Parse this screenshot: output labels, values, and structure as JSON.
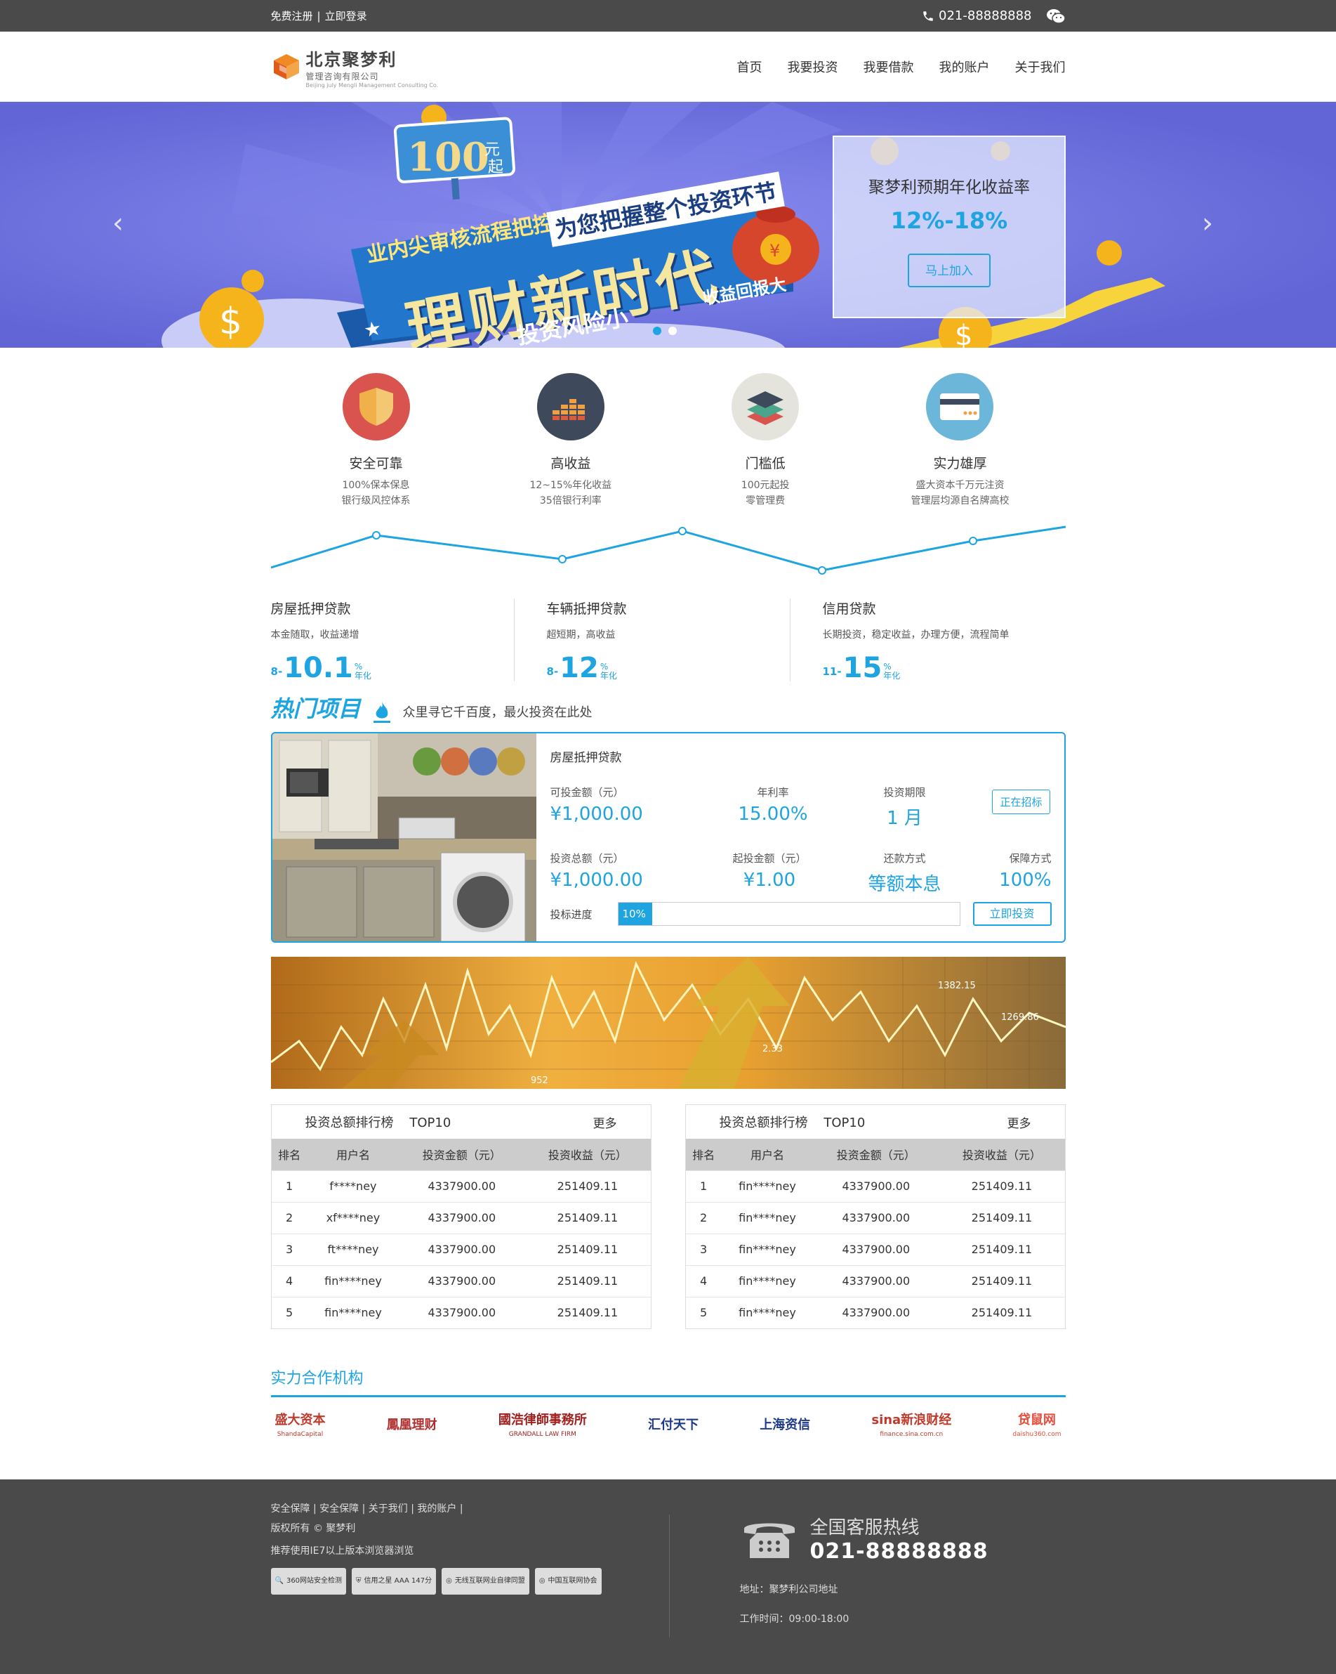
{
  "topbar": {
    "register": "免费注册",
    "sep": "|",
    "login": "立即登录",
    "phone": "021-88888888",
    "wechat_icon": "wechat-icon"
  },
  "logo": {
    "line1": "北京聚梦利",
    "line2": "管理咨询有限公司",
    "line3": "Beijing july Mengli Management Consulting Co."
  },
  "nav": [
    "首页",
    "我要投资",
    "我要借款",
    "我的账户",
    "关于我们"
  ],
  "banner": {
    "tag_num": "100",
    "tag_unit1": "元",
    "tag_unit2": "起",
    "line1": "业内尖审核流程把控",
    "line2": "为您把握整个投资环节",
    "main": "理财新时代",
    "sub": "投资风险小",
    "sub2": "收益回报大",
    "rate_title": "聚梦利预期年化收益率",
    "rate_value": "12%-18%",
    "join": "马上加入",
    "colors": {
      "bg": "#6b6fe0",
      "accent": "#1ea4e0"
    }
  },
  "features": [
    {
      "title": "安全可靠",
      "d1": "100%保本保息",
      "d2": "银行级风控体系",
      "icon": "shield-icon",
      "color": "#d9534f"
    },
    {
      "title": "高收益",
      "d1": "12~15%年化收益",
      "d2": "35倍银行利率",
      "icon": "bar-chart-icon",
      "color": "#3e4a5c"
    },
    {
      "title": "门槛低",
      "d1": "100元起投",
      "d2": "零管理费",
      "icon": "layers-icon",
      "color": "#e4e4dc"
    },
    {
      "title": "实力雄厚",
      "d1": "盛大资本千万元注资",
      "d2": "管理层均源自名牌高校",
      "icon": "card-icon",
      "color": "#6cb6d9"
    }
  ],
  "loans": [
    {
      "title": "房屋抵押贷款",
      "desc": "本金随取，收益递增",
      "min": "8",
      "max": "10.1",
      "unit_top": "%",
      "unit_bottom": "年化"
    },
    {
      "title": "车辆抵押贷款",
      "desc": "超短期，高收益",
      "min": "8",
      "max": "12",
      "unit_top": "%",
      "unit_bottom": "年化"
    },
    {
      "title": "信用贷款",
      "desc": "长期投资，稳定收益，办理方便，流程简单",
      "min": "11",
      "max": "15",
      "unit_top": "%",
      "unit_bottom": "年化"
    }
  ],
  "hot": {
    "title": "热门项目",
    "subtitle": "众里寻它千百度，最火投资在此处",
    "project": {
      "name": "房屋抵押贷款",
      "k1": "可投金额（元）",
      "v1": "¥1,000.00",
      "k2": "年利率",
      "v2": "15.00%",
      "k3": "投资期限",
      "v3": "1 月",
      "k4": "投资总额（元）",
      "v4": "¥1,000.00",
      "k5": "起投金额（元）",
      "v5": "¥1.00",
      "k6": "还款方式",
      "v6": "等额本息",
      "k7": "保障方式",
      "v7": "100%",
      "status": "正在招标",
      "progress_label": "投标进度",
      "progress_text": "10%",
      "progress": 0.1,
      "invest": "立即投资"
    }
  },
  "stock_labels": [
    "1382.15",
    "1269.86",
    "2.33",
    "952"
  ],
  "rank_tables": [
    {
      "title": "投资总额排行榜",
      "top": "TOP10",
      "more": "更多",
      "headers": [
        "排名",
        "用户名",
        "投资金额（元）",
        "投资收益（元）"
      ],
      "rows": [
        [
          "1",
          "f****ney",
          "4337900.00",
          "251409.11"
        ],
        [
          "2",
          "xf****ney",
          "4337900.00",
          "251409.11"
        ],
        [
          "3",
          "ft****ney",
          "4337900.00",
          "251409.11"
        ],
        [
          "4",
          "fin****ney",
          "4337900.00",
          "251409.11"
        ],
        [
          "5",
          "fin****ney",
          "4337900.00",
          "251409.11"
        ]
      ]
    },
    {
      "title": "投资总额排行榜",
      "top": "TOP10",
      "more": "更多",
      "headers": [
        "排名",
        "用户名",
        "投资金额（元）",
        "投资收益（元）"
      ],
      "rows": [
        [
          "1",
          "fin****ney",
          "4337900.00",
          "251409.11"
        ],
        [
          "2",
          "fin****ney",
          "4337900.00",
          "251409.11"
        ],
        [
          "3",
          "fin****ney",
          "4337900.00",
          "251409.11"
        ],
        [
          "4",
          "fin****ney",
          "4337900.00",
          "251409.11"
        ],
        [
          "5",
          "fin****ney",
          "4337900.00",
          "251409.11"
        ]
      ]
    }
  ],
  "partners": {
    "title": "实力合作机构",
    "logos": [
      {
        "name": "盛大资本",
        "sub": "ShandaCapital",
        "color": "#c0392b"
      },
      {
        "name": "鳳凰理财",
        "sub": "",
        "color": "#b03030"
      },
      {
        "name": "國浩律師事務所",
        "sub": "GRANDALL LAW FIRM",
        "color": "#a02020"
      },
      {
        "name": "汇付天下",
        "sub": "",
        "color": "#1e3a8a"
      },
      {
        "name": "上海资信",
        "sub": "",
        "color": "#1e3a8a"
      },
      {
        "name": "sina新浪财经",
        "sub": "finance.sina.com.cn",
        "color": "#c0392b"
      },
      {
        "name": "贷鼠网",
        "sub": "daishu360.com",
        "color": "#e74c3c"
      }
    ]
  },
  "footer": {
    "links": [
      "安全保障",
      "安全保障",
      "关于我们",
      "我的账户"
    ],
    "copyright": "版权所有 © 聚梦利",
    "browser": "推荐使用IE7以上版本浏览器浏览",
    "badges": [
      "360网站安全检测",
      "信用之星 AAA 147分",
      "无线互联网业自律同盟",
      "中国互联网协会"
    ],
    "hotline_label": "全国客服热线",
    "hotline": "021-88888888",
    "address": "地址：聚梦利公司地址",
    "hours": "工作时间：09:00-18:00"
  }
}
